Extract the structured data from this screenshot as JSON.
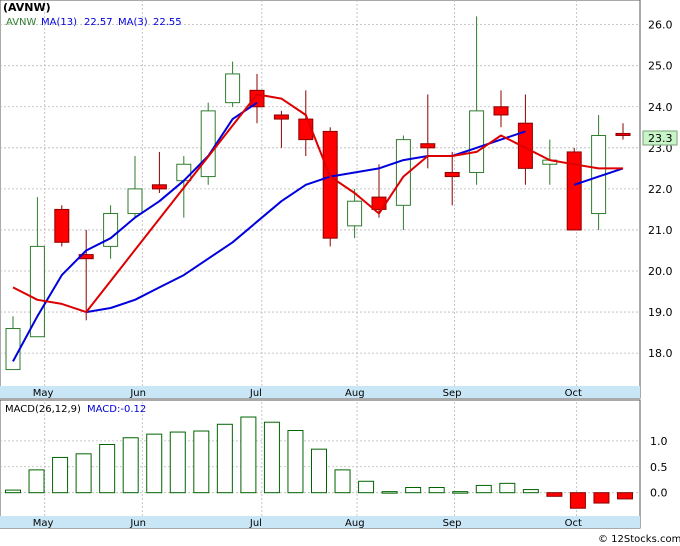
{
  "header": {
    "ticker": "(AVNW)",
    "legend_symbol": "AVNW",
    "ma13_label": "MA(13)",
    "ma13_value": "22.57",
    "ma3_label": "MA(3)",
    "ma3_value": "22.55"
  },
  "macd_header": {
    "label": "MACD(26,12,9)",
    "value_label": "MACD:-0.12"
  },
  "watermark": "© 12Stocks.com",
  "last_price_label": "23.3",
  "colors": {
    "up_candle": "#2e7d2e",
    "down_candle": "#ff0000",
    "ma13": "#0000dd",
    "ma3": "#dd0000",
    "macd_bar": "#006400",
    "macd_neg": "#ff0000",
    "axis_band": "#c8e6f5",
    "grid": "#b8b8b8",
    "price_tag_bg": "#c8f5c8"
  },
  "chart_data": [
    {
      "type": "candlestick",
      "title": "(AVNW)",
      "x_tick_labels": [
        "May",
        "Jun",
        "Jul",
        "Aug",
        "Sep",
        "Oct"
      ],
      "x_tick_weeks": [
        1.3,
        5.3,
        10.2,
        14.1,
        18.1,
        23.1
      ],
      "ylim": [
        17.2,
        26.6
      ],
      "y_ticks": [
        18.0,
        19.0,
        20.0,
        21.0,
        22.0,
        23.0,
        24.0,
        25.0,
        26.0
      ],
      "y_tick_labels": [
        "18.0",
        "19.0",
        "20.0",
        "21.0",
        "22.0",
        "23.0",
        "24.0",
        "25.0",
        "26.0"
      ],
      "candles": [
        {
          "week": 0,
          "open": 17.6,
          "close": 18.6,
          "high": 18.9,
          "low": 17.6
        },
        {
          "week": 1,
          "open": 18.4,
          "close": 20.6,
          "high": 21.8,
          "low": 18.4
        },
        {
          "week": 2,
          "open": 21.5,
          "close": 20.7,
          "high": 21.6,
          "low": 20.6
        },
        {
          "week": 3,
          "open": 20.4,
          "close": 20.3,
          "high": 21.0,
          "low": 18.8
        },
        {
          "week": 4,
          "open": 20.6,
          "close": 21.4,
          "high": 21.6,
          "low": 20.3
        },
        {
          "week": 5,
          "open": 21.4,
          "close": 22.0,
          "high": 22.8,
          "low": 21.3
        },
        {
          "week": 6,
          "open": 22.1,
          "close": 22.0,
          "high": 22.9,
          "low": 21.9
        },
        {
          "week": 7,
          "open": 22.2,
          "close": 22.6,
          "high": 22.8,
          "low": 21.3
        },
        {
          "week": 8,
          "open": 22.3,
          "close": 23.9,
          "high": 24.1,
          "low": 22.1
        },
        {
          "week": 9,
          "open": 24.1,
          "close": 24.8,
          "high": 25.1,
          "low": 24.0
        },
        {
          "week": 10,
          "open": 24.4,
          "close": 24.0,
          "high": 24.8,
          "low": 23.6
        },
        {
          "week": 11,
          "open": 23.8,
          "close": 23.7,
          "high": 23.9,
          "low": 23.0
        },
        {
          "week": 12,
          "open": 23.7,
          "close": 23.2,
          "high": 24.4,
          "low": 22.8
        },
        {
          "week": 13,
          "open": 23.4,
          "close": 20.8,
          "high": 23.5,
          "low": 20.6
        },
        {
          "week": 14,
          "open": 21.1,
          "close": 21.7,
          "high": 22.0,
          "low": 20.8
        },
        {
          "week": 15,
          "open": 21.8,
          "close": 21.5,
          "high": 22.6,
          "low": 21.3
        },
        {
          "week": 16,
          "open": 21.6,
          "close": 23.2,
          "high": 23.3,
          "low": 21.0
        },
        {
          "week": 17,
          "open": 23.1,
          "close": 23.0,
          "high": 24.3,
          "low": 22.5
        },
        {
          "week": 18,
          "open": 22.4,
          "close": 22.3,
          "high": 22.9,
          "low": 21.6
        },
        {
          "week": 19,
          "open": 22.4,
          "close": 23.9,
          "high": 26.2,
          "low": 22.1
        },
        {
          "week": 20,
          "open": 24.0,
          "close": 23.8,
          "high": 24.4,
          "low": 23.5
        },
        {
          "week": 21,
          "open": 23.6,
          "close": 22.5,
          "high": 24.3,
          "low": 22.1
        },
        {
          "week": 22,
          "open": 22.6,
          "close": 22.7,
          "high": 23.2,
          "low": 22.1
        },
        {
          "week": 23,
          "open": 22.9,
          "close": 21.0,
          "high": 23.0,
          "low": 21.0
        },
        {
          "week": 24,
          "open": 21.4,
          "close": 23.3,
          "high": 23.8,
          "low": 21.0
        },
        {
          "week": 25,
          "open": 23.35,
          "close": 23.3,
          "high": 23.6,
          "low": 23.2
        }
      ],
      "series": [
        {
          "name": "MA(13)",
          "weeks": [
            0,
            1,
            2,
            3,
            4,
            5,
            6,
            7,
            8,
            9,
            10,
            11,
            12,
            13,
            14,
            15,
            16,
            17,
            18,
            19,
            20,
            21,
            22,
            23,
            24,
            25
          ],
          "values": [
            17.8,
            18.9,
            19.9,
            20.5,
            20.8,
            21.3,
            21.7,
            22.2,
            22.8,
            23.7,
            24.1,
            null,
            null,
            null,
            null,
            null,
            null,
            null,
            null,
            null,
            null,
            null,
            null,
            null,
            null,
            null
          ]
        },
        {
          "name": "MA(13)",
          "weeks": [
            3,
            4,
            5,
            6,
            7,
            8,
            9,
            10,
            11,
            12,
            13,
            14,
            15,
            16,
            17,
            18,
            19,
            20,
            21,
            22,
            23,
            24,
            25
          ],
          "values": [
            19.0,
            19.1,
            19.3,
            19.6,
            19.9,
            20.3,
            20.7,
            21.2,
            21.7,
            22.1,
            22.3,
            22.4,
            22.5,
            22.7,
            22.8,
            22.8,
            23.0,
            23.2,
            23.4,
            null,
            22.1,
            22.3,
            22.5
          ]
        },
        {
          "name": "MA(3)",
          "weeks": [
            0,
            1,
            2,
            3,
            10,
            11,
            12,
            13,
            14,
            15,
            16,
            17,
            18,
            19,
            20,
            21,
            22,
            23,
            24,
            25
          ],
          "values": [
            19.6,
            19.3,
            19.2,
            19.0,
            24.3,
            24.2,
            23.8,
            22.3,
            21.9,
            21.4,
            22.3,
            22.8,
            22.8,
            22.9,
            23.3,
            23.0,
            22.7,
            22.6,
            22.5,
            22.5
          ]
        }
      ]
    },
    {
      "type": "bar",
      "title": "MACD(26,12,9)",
      "ylim": [
        -0.45,
        1.75
      ],
      "y_ticks": [
        0.0,
        0.5,
        1.0
      ],
      "y_tick_labels": [
        "0.0",
        "0.5",
        "1.0"
      ],
      "x_tick_labels": [
        "May",
        "Jun",
        "Jul",
        "Aug",
        "Sep",
        "Oct"
      ],
      "values": [
        0.05,
        0.44,
        0.68,
        0.75,
        0.93,
        1.06,
        1.13,
        1.17,
        1.19,
        1.32,
        1.46,
        1.36,
        1.2,
        0.84,
        0.44,
        0.22,
        0.02,
        0.1,
        0.1,
        0.02,
        0.14,
        0.18,
        0.06,
        -0.07,
        -0.3,
        -0.2,
        -0.12
      ]
    }
  ]
}
